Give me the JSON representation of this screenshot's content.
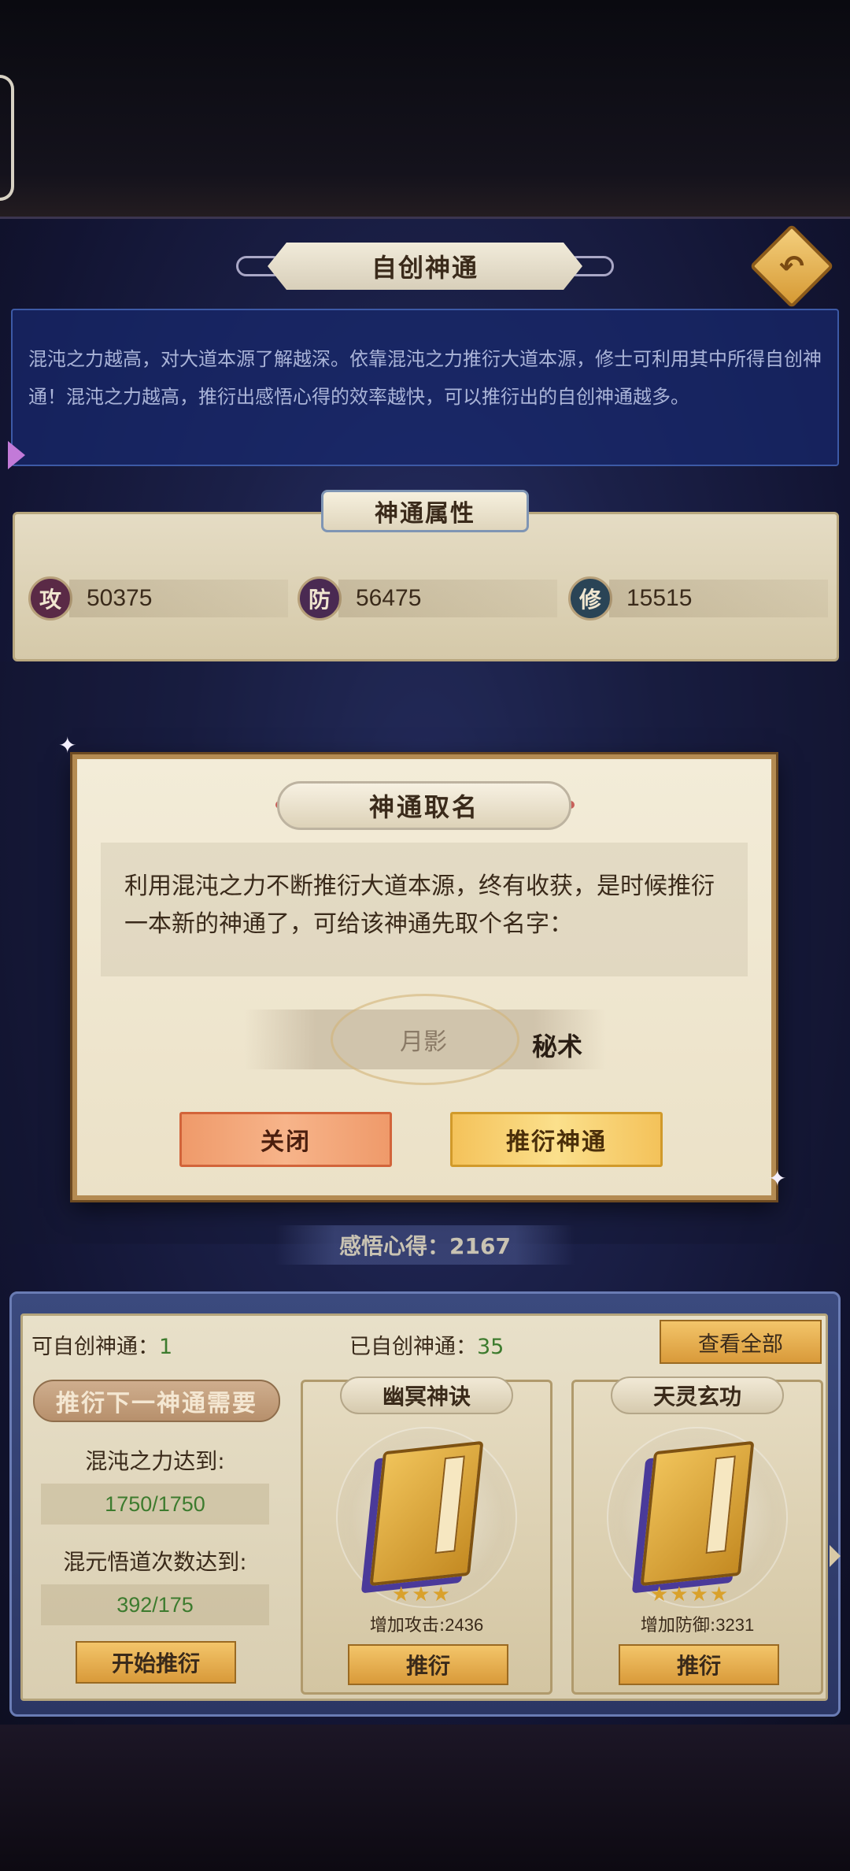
{
  "header": {
    "title": "自创神通"
  },
  "description": "混沌之力越高，对大道本源了解越深。依靠混沌之力推衍大道本源，修士可利用其中所得自创神通！混沌之力越高，推衍出感悟心得的效率越快，可以推衍出的自创神通越多。",
  "attributes": {
    "title": "神通属性",
    "items": [
      {
        "icon_label": "攻",
        "value": "50375",
        "color": "#5a2a46"
      },
      {
        "icon_label": "防",
        "value": "56475",
        "color": "#4a2a52"
      },
      {
        "icon_label": "修",
        "value": "15515",
        "color": "#2a4456"
      }
    ]
  },
  "modal": {
    "title": "神通取名",
    "message": "利用混沌之力不断推衍大道本源，终有收获，是时候推衍一本新的神通了，可给该神通先取个名字：",
    "name_part_left": "月影",
    "name_part_right": "秘术",
    "close_label": "关闭",
    "confirm_label": "推衍神通"
  },
  "insight": {
    "text": "感悟心得：2167"
  },
  "bottom": {
    "can_create_label": "可自创神通：",
    "can_create_value": "1",
    "created_label": "已自创神通：",
    "created_value": "35",
    "view_all_label": "查看全部",
    "requirement": {
      "title": "推衍下一神通需要",
      "chaos_label": "混沌之力达到:",
      "chaos_value": "1750/1750",
      "times_label": "混元悟道次数达到:",
      "times_value": "392/175",
      "start_label": "开始推衍"
    },
    "cards": [
      {
        "name": "幽冥神诀",
        "stars": "★★★",
        "effect_label": "增加攻击:",
        "effect_value": "2436",
        "button_label": "推衍"
      },
      {
        "name": "天灵玄功",
        "stars": "★★★★",
        "effect_label": "增加防御:",
        "effect_value": "3231",
        "button_label": "推衍"
      }
    ]
  },
  "icons": {
    "back": "back-arrow-icon",
    "side": "left-arrow-icon",
    "sparkle": "sparkle-icon",
    "scroll": "scroll-right-icon"
  },
  "colors": {
    "accent_gold": "#d99a3a",
    "positive_green": "#3d7b2e",
    "panel_blue": "#1b2048"
  }
}
